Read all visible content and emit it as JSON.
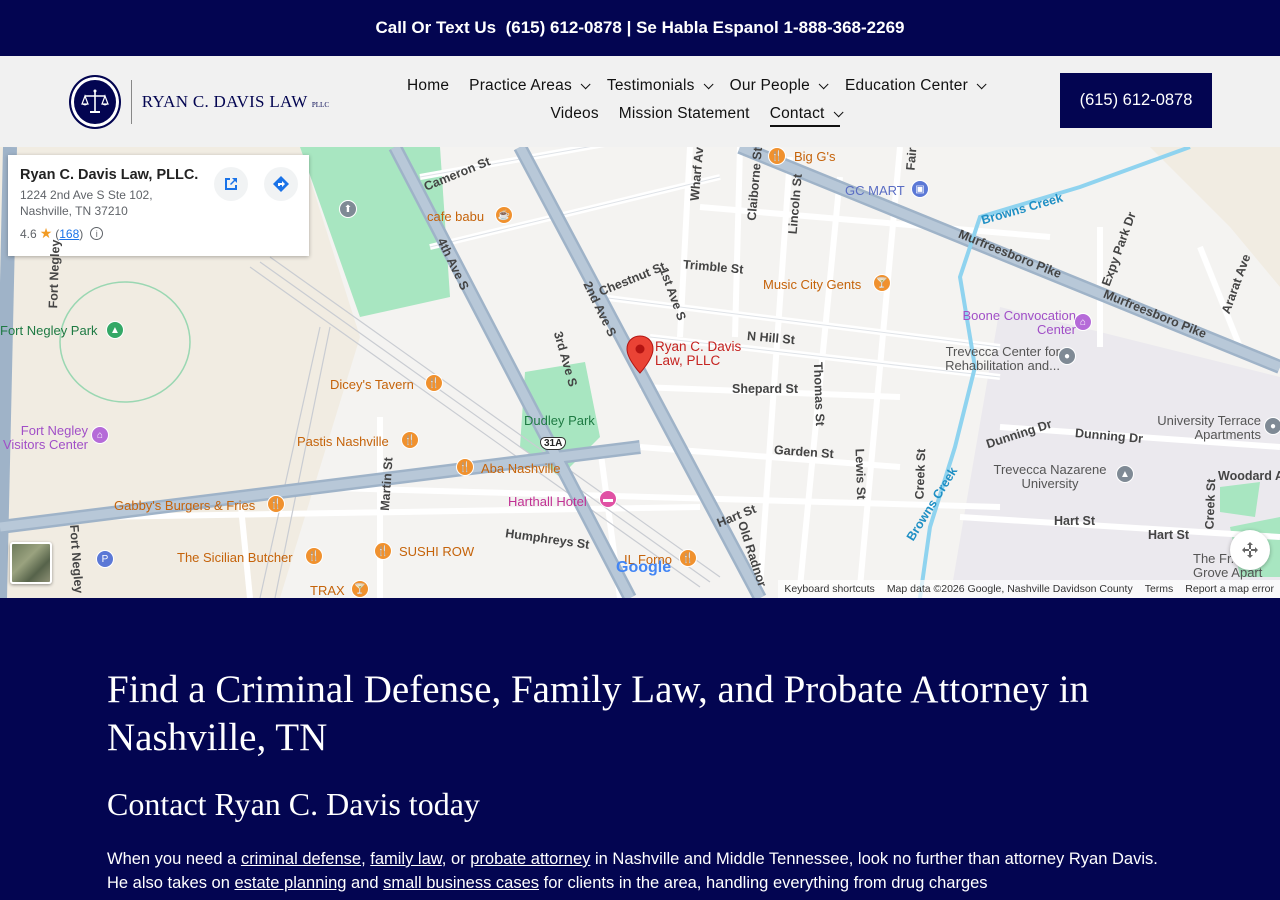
{
  "topbar": {
    "call_label": "Call Or Text Us",
    "call_phone": "(615) 612-0878",
    "separator": "|",
    "spanish_label": "Se Habla Espanol",
    "spanish_phone": "1-888-368-2269"
  },
  "logo": {
    "name": "RYAN C. DAVIS LAW",
    "suffix": "PLLC"
  },
  "nav": {
    "row1": [
      {
        "label": "Home",
        "dropdown": false
      },
      {
        "label": "Practice Areas",
        "dropdown": true
      },
      {
        "label": "Testimonials",
        "dropdown": true
      },
      {
        "label": "Our People",
        "dropdown": true
      },
      {
        "label": "Education Center",
        "dropdown": true
      }
    ],
    "row2": [
      {
        "label": "Videos",
        "dropdown": false
      },
      {
        "label": "Mission Statement",
        "dropdown": false
      },
      {
        "label": "Contact",
        "dropdown": true,
        "active": true
      }
    ]
  },
  "header_phone": "(615) 612-0878",
  "map": {
    "card": {
      "title": "Ryan C. Davis Law, PLLC.",
      "address": "1224 2nd Ave S Ste 102, Nashville, TN 37210",
      "rating": "4.6",
      "reviews": "168"
    },
    "marker_label": "Ryan C. Davis Law, PLLC",
    "streets": {
      "fourth_ave": "4th Ave S",
      "second_ave": "2nd Ave S",
      "third_ave": "3rd Ave S",
      "first_ave": "1st Ave S",
      "chestnut": "Chestnut St",
      "cameron": "Cameron St",
      "trimble": "Trimble St",
      "n_hill": "N Hill St",
      "shepard": "Shepard St",
      "garden": "Garden St",
      "thomas": "Thomas St",
      "lewis": "Lewis St",
      "claiborne": "Claiborne St",
      "lincoln": "Lincoln St",
      "wharf": "Wharf Av",
      "martin": "Martin St",
      "humphreys": "Humphreys St",
      "hart": "Hart St",
      "hart2": "Hart St",
      "hart3": "Hart St",
      "old_radnor": "Old Radnor",
      "murfreesboro1": "Murfreesboro Pike",
      "murfreesboro2": "Murfreesboro Pike",
      "browns_creek1": "Browns Creek",
      "browns_creek2": "Browns Creek",
      "dunning1": "Dunning Dr",
      "dunning2": "Dunning Dr",
      "fort_negley_ave": "Fort Negley",
      "fort_negley_ave2": "Fort Negley",
      "creek_st": "Creek St",
      "creek_st2": "Creek St",
      "woodard": "Woodard Av",
      "expy_park": "Expy Park Dr",
      "ararat": "Ararat Ave",
      "fair": "Fair",
      "route": "31A"
    },
    "pois": {
      "big_gs": "Big G's",
      "gc_mart": "GC MART",
      "cafe_babu": "cafe babu",
      "music_city_gents": "Music City Gents",
      "boone": "Boone Convocation Center",
      "trevecca_center": "Trevecca Center for Rehabilitation and...",
      "fort_negley_park": "Fort Negley Park",
      "dicey": "Dicey's Tavern",
      "dudley_park": "Dudley Park",
      "fort_negley_visitors": "Fort Negley Visitors Center",
      "pastis": "Pastis Nashville",
      "aba": "Aba Nashville",
      "harthall": "Harthall Hotel",
      "gabbys": "Gabby's Burgers & Fries",
      "sicilian": "The Sicilian Butcher",
      "sushi": "SUSHI ROW",
      "il_forno": "IL Forno",
      "trax": "TRAX",
      "university_terrace": "University Terrace Apartments",
      "trevecca_nazarene": "Trevecca Nazarene University",
      "the_fr": "The Fr... W Grove Apart"
    },
    "google": "Google",
    "footer": {
      "shortcuts": "Keyboard shortcuts",
      "mapdata": "Map data ©2026 Google, Nashville Davidson County",
      "terms": "Terms",
      "report": "Report a map error"
    }
  },
  "content": {
    "heading": "Find a Criminal Defense, Family Law, and Probate Attorney in Nashville, TN",
    "subheading": "Contact Ryan C. Davis today",
    "para": {
      "t1": "When you need a ",
      "l1": "criminal defense",
      "t2": ", ",
      "l2": "family law",
      "t3": ", or ",
      "l3": "probate attorney",
      "t4": " in Nashville and Middle Tennessee, look no further than attorney Ryan Davis. He also takes on ",
      "l4": "estate planning",
      "t5": " and ",
      "l5": "small business cases",
      "t6": " for clients in the area, handling everything from drug charges"
    }
  },
  "colors": {
    "navy": "#030551",
    "header_bg": "#f1f1f1",
    "marker_red": "#e53935",
    "poi_orange": "#f0912e"
  }
}
